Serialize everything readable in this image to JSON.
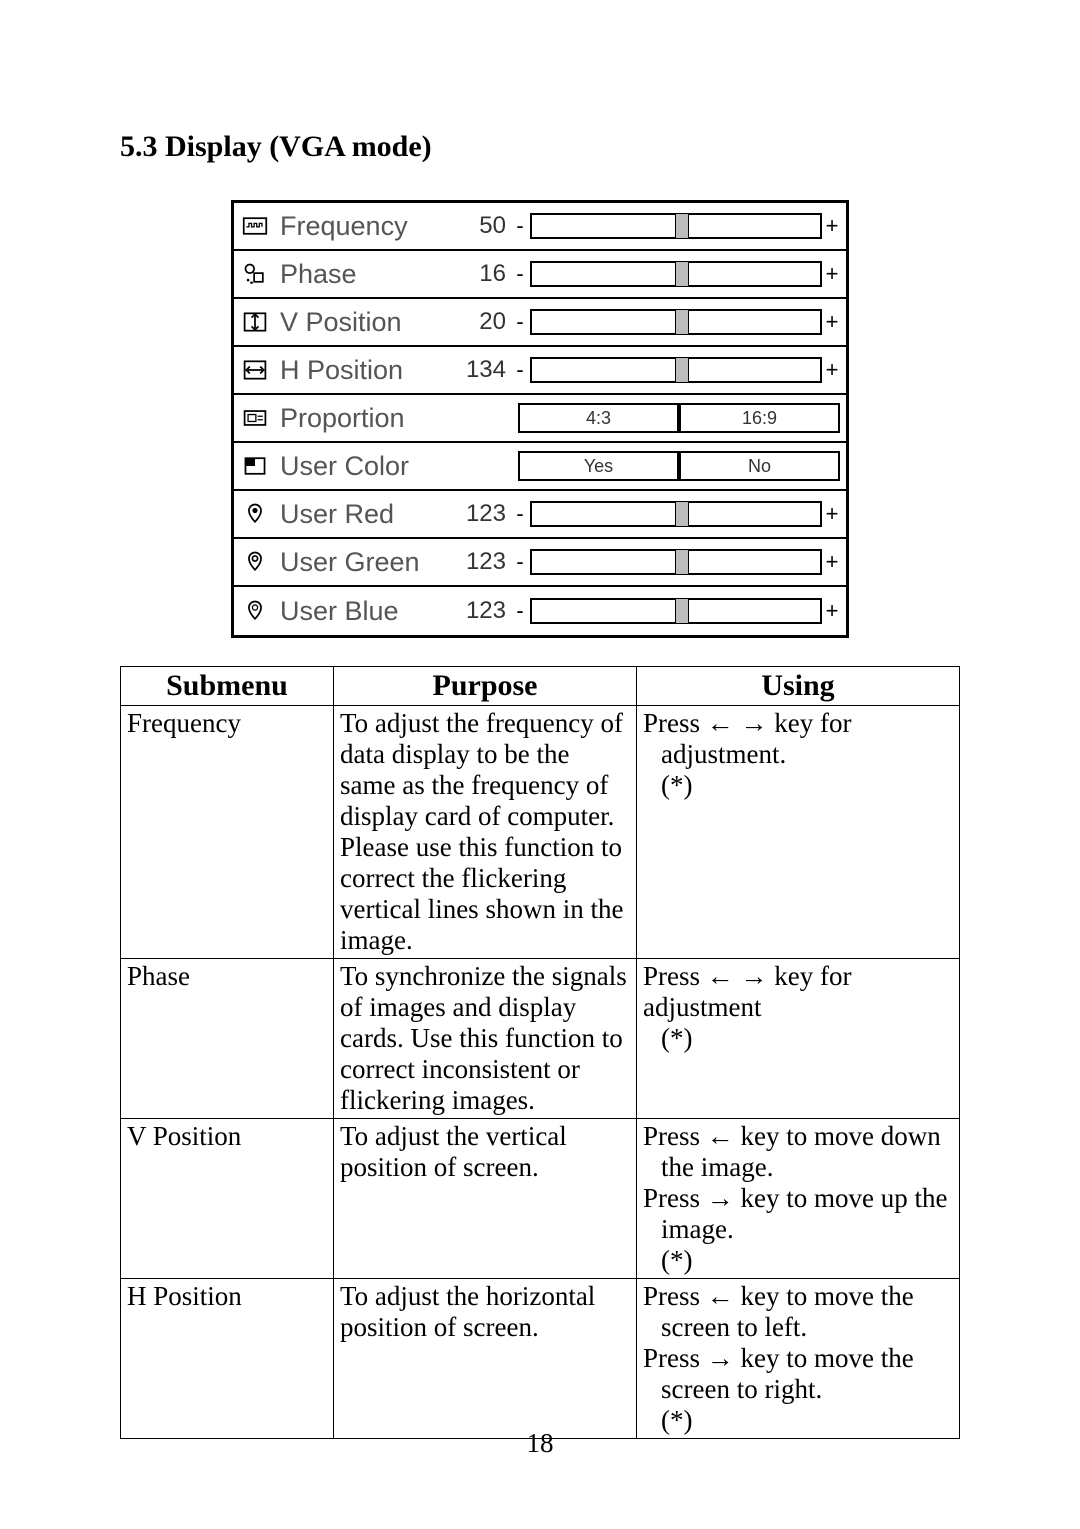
{
  "section_title": "5.3 Display (VGA mode)",
  "page_number": "18",
  "osd": {
    "rows": [
      {
        "icon": "frequency-icon",
        "label": "Frequency",
        "value": "50",
        "type": "slider",
        "thumb_pct": 52
      },
      {
        "icon": "phase-icon",
        "label": "Phase",
        "value": "16",
        "type": "slider",
        "thumb_pct": 52
      },
      {
        "icon": "vpos-icon",
        "label": "V Position",
        "value": "20",
        "type": "slider",
        "thumb_pct": 52
      },
      {
        "icon": "hpos-icon",
        "label": "H Position",
        "value": "134",
        "type": "slider",
        "thumb_pct": 52
      },
      {
        "icon": "proportion-icon",
        "label": "Proportion",
        "type": "choice",
        "options": [
          "4:3",
          "16:9"
        ]
      },
      {
        "icon": "usercolor-icon",
        "label": "User Color",
        "type": "choice",
        "options": [
          "Yes",
          "No"
        ]
      },
      {
        "icon": "userred-icon",
        "label": "User Red",
        "value": "123",
        "type": "slider",
        "thumb_pct": 52
      },
      {
        "icon": "usergreen-icon",
        "label": "User Green",
        "value": "123",
        "type": "slider",
        "thumb_pct": 52
      },
      {
        "icon": "userblue-icon",
        "label": "User Blue",
        "value": "123",
        "type": "slider",
        "thumb_pct": 52
      }
    ]
  },
  "table": {
    "headers": [
      "Submenu",
      "Purpose",
      "Using"
    ],
    "rows": [
      {
        "submenu": "Frequency",
        "purpose": "To adjust the frequency of data display to be the same as the frequency of display card of computer. Please use this function to correct the flickering vertical lines shown in the image.",
        "using": [
          "Press ← → key for",
          "adjustment.",
          " (*)"
        ]
      },
      {
        "submenu": "Phase",
        "purpose": "To synchronize the signals of images and display cards. Use this function to correct inconsistent or flickering images.",
        "using": [
          "Press ← → key for adjustment",
          " (*)"
        ]
      },
      {
        "submenu": "V Position",
        "purpose": "To adjust the vertical position of screen.",
        "using": [
          "Press ← key to move down",
          " the image.",
          "Press → key to move up the",
          " image.",
          " (*)"
        ]
      },
      {
        "submenu": "H Position",
        "purpose": "To adjust the horizontal position of screen.",
        "using": [
          "Press ← key to move the",
          " screen to left.",
          "Press → key to move the",
          " screen to right.",
          " (*)"
        ]
      }
    ]
  }
}
